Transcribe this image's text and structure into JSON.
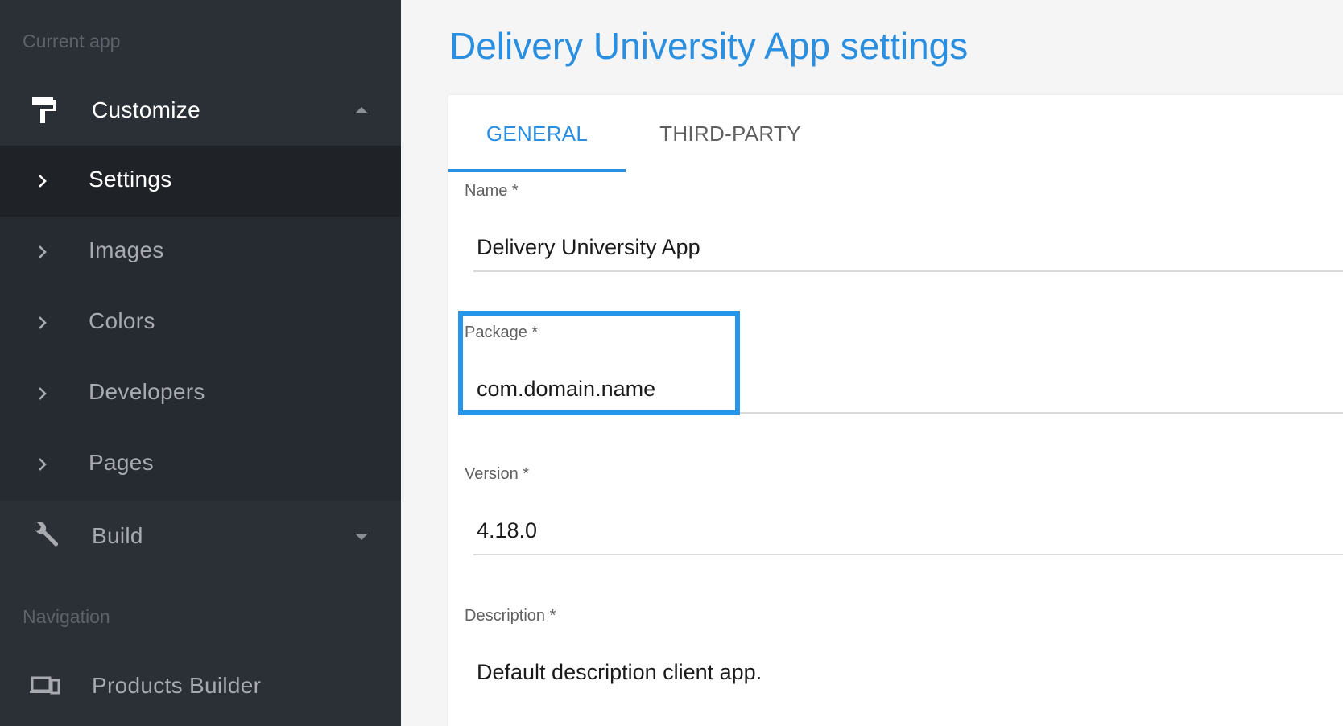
{
  "sidebar": {
    "current_app_label": "Current app",
    "navigation_label": "Navigation",
    "customize": {
      "label": "Customize",
      "icon": "paint-roller-icon",
      "expanded": true
    },
    "sub_items": [
      {
        "label": "Settings",
        "active": true
      },
      {
        "label": "Images",
        "active": false
      },
      {
        "label": "Colors",
        "active": false
      },
      {
        "label": "Developers",
        "active": false
      },
      {
        "label": "Pages",
        "active": false
      }
    ],
    "build": {
      "label": "Build",
      "icon": "wrench-icon",
      "expanded": false
    },
    "products_builder": {
      "label": "Products Builder",
      "icon": "devices-icon"
    }
  },
  "main": {
    "title": "Delivery University App settings",
    "tabs": [
      {
        "label": "GENERAL",
        "active": true
      },
      {
        "label": "THIRD-PARTY",
        "active": false
      }
    ],
    "fields": {
      "name": {
        "label": "Name *",
        "value": "Delivery University App"
      },
      "package": {
        "label": "Package *",
        "value": "com.domain.name"
      },
      "version": {
        "label": "Version *",
        "value": "4.18.0"
      },
      "description": {
        "label": "Description *",
        "value": "Default description client app."
      }
    }
  },
  "colors": {
    "accent": "#2a8fe0",
    "highlight": "#2596e9",
    "sidebar_bg": "#2b2f36",
    "sidebar_active": "#1f2328"
  }
}
